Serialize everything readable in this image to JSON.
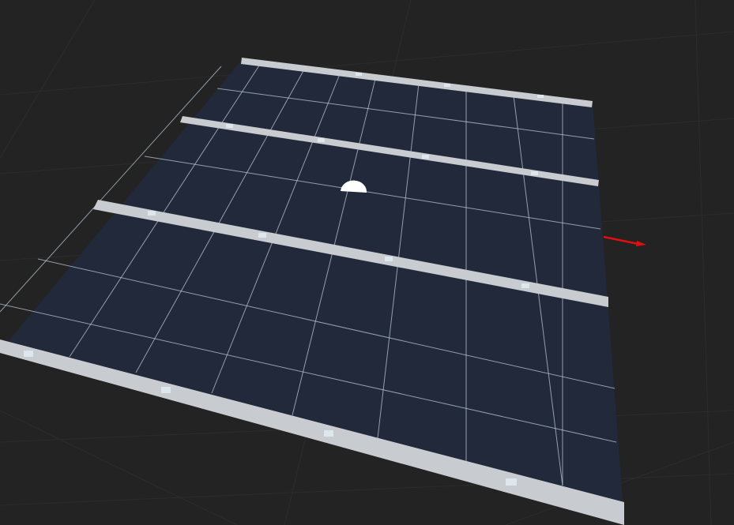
{
  "scene": {
    "background_color": "#232323",
    "ground_grid_color": "#2c2c2c",
    "floor_color": "#22293a",
    "floor_edge_color": "#2b3a52",
    "grid_line_color": "#b9c6d6",
    "wall_color": "#c8ccd0",
    "wall_marker_color": "#dde7ee",
    "agent_color": "#ffffff",
    "axis_arrow_color": "#e01010",
    "walls": [
      {
        "name": "back-wall",
        "markers": 3
      },
      {
        "name": "inner-wall-upper",
        "markers": 4
      },
      {
        "name": "inner-wall-lower",
        "markers": 4
      },
      {
        "name": "front-wall",
        "markers": 4
      }
    ],
    "agent": {
      "shape": "half-sphere"
    },
    "axis_indicator": {
      "axis": "x"
    }
  }
}
